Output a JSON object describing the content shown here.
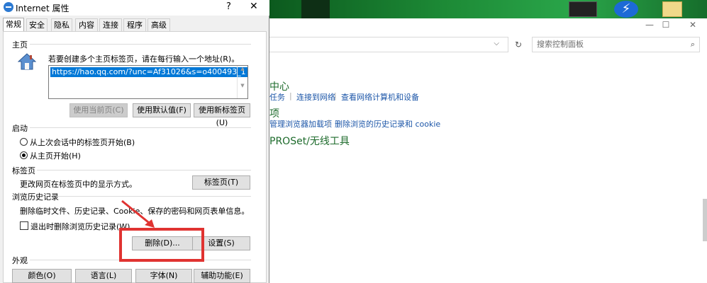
{
  "dialog": {
    "title": "Internet 属性",
    "help": "?",
    "close": "✕",
    "tabs": [
      "常规",
      "安全",
      "隐私",
      "内容",
      "连接",
      "程序",
      "高级"
    ],
    "active_tab": "常规",
    "home": {
      "label": "主页",
      "hint": "若要创建多个主页标签页，请在每行输入一个地址(R)。",
      "url": "https://hao.qq.com/?unc=Af31026&s=o400493_1",
      "btn_current": "使用当前页(C)",
      "btn_default": "使用默认值(F)",
      "btn_newtab": "使用新标签页(U)"
    },
    "startup": {
      "label": "启动",
      "opt_last": "从上次会话中的标签页开始(B)",
      "opt_home": "从主页开始(H)",
      "selected": "opt_home"
    },
    "tabs_section": {
      "label": "标签页",
      "hint": "更改网页在标签页中的显示方式。",
      "btn": "标签页(T)"
    },
    "history": {
      "label": "浏览历史记录",
      "hint": "删除临时文件、历史记录、Cookie、保存的密码和网页表单信息。",
      "check_label": "退出时删除浏览历史记录(W)",
      "checked": false,
      "btn_delete": "删除(D)...",
      "btn_settings": "设置(S)"
    },
    "appearance": {
      "label": "外观",
      "btn_colors": "颜色(O)",
      "btn_lang": "语言(L)",
      "btn_fonts": "字体(N)",
      "btn_access": "辅助功能(E)"
    }
  },
  "control_panel": {
    "minimize": "—",
    "maximize": "☐",
    "close": "✕",
    "search_placeholder": "搜索控制面板",
    "heading1": "中心",
    "link_task": "任务",
    "link_connect": "连接到网络",
    "link_view": "查看网络计算机和设备",
    "heading2": "项",
    "link_manage": "管理浏览器加载项",
    "link_delete": "删除浏览的历史记录和 cookie",
    "heading3": "PROSet/无线工具"
  },
  "colors": {
    "highlight": "#e03331",
    "link": "#1c56a8",
    "heading": "#1e6b2c",
    "selection": "#0078d7"
  }
}
